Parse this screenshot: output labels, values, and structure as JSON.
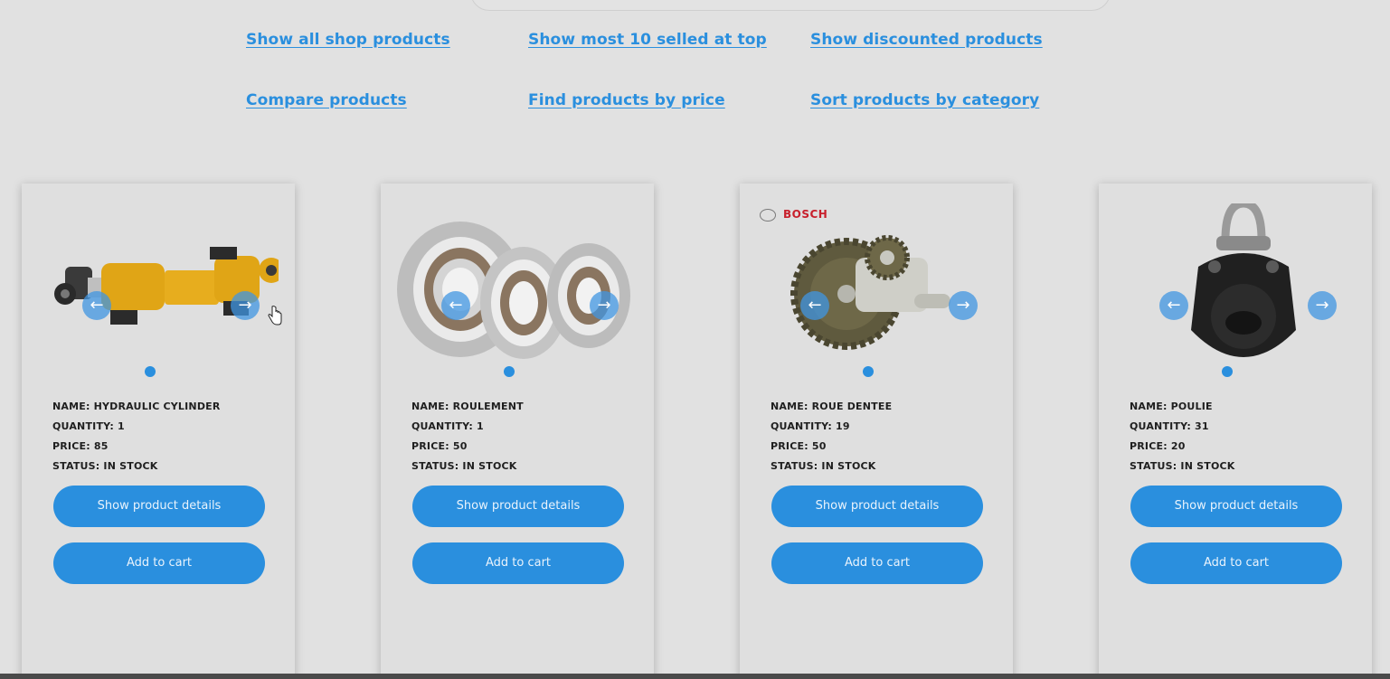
{
  "nav": {
    "show_all": "Show all shop products",
    "show_top10": "Show most 10 selled at top",
    "show_discounted": "Show discounted products",
    "compare": "Compare products",
    "find_by_price": "Find products by price",
    "sort_by_category": "Sort products by category"
  },
  "products": [
    {
      "name": "NAME: HYDRAULIC CYLINDER",
      "quantity": "QUANTITY: 1",
      "price": "PRICE: 85",
      "status": "STATUS: IN STOCK",
      "details_label": "Show product details",
      "cart_label": "Add to cart"
    },
    {
      "name": "NAME: ROULEMENT",
      "quantity": "QUANTITY: 1",
      "price": "PRICE: 50",
      "status": "STATUS: IN STOCK",
      "details_label": "Show product details",
      "cart_label": "Add to cart"
    },
    {
      "name": "NAME: ROUE DENTEE",
      "quantity": "QUANTITY: 19",
      "price": "PRICE: 50",
      "status": "STATUS: IN STOCK",
      "details_label": "Show product details",
      "cart_label": "Add to cart",
      "brand": "BOSCH"
    },
    {
      "name": "NAME: POULIE",
      "quantity": "QUANTITY: 31",
      "price": "PRICE: 20",
      "status": "STATUS: IN STOCK",
      "details_label": "Show product details",
      "cart_label": "Add to cart"
    }
  ],
  "icons": {
    "prev": "arrow-left-icon",
    "next": "arrow-right-icon"
  },
  "colors": {
    "accent": "#2a8fde",
    "background": "#e1e1e1",
    "brand_red": "#c8202c"
  }
}
